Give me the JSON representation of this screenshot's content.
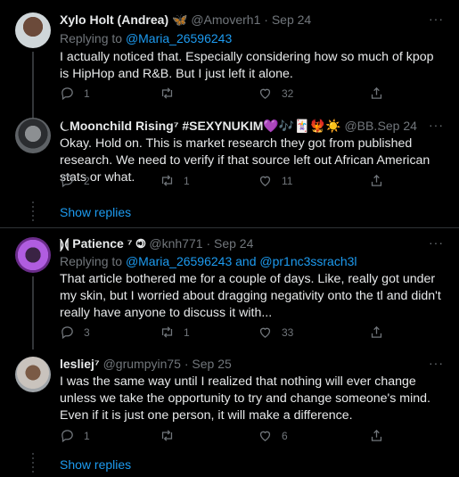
{
  "tweets": [
    {
      "name": "Xylo Holt (Andrea) 🦋",
      "handle": "@Amoverh1",
      "date": "Sep 24",
      "reply_prefix": "Replying to",
      "reply_mentions": "@Maria_26596243",
      "text": "I actually noticed that. Especially considering how so much of kpop is HipHop and R&B. But I just left it alone.",
      "replies": "1",
      "retweets": "",
      "likes": "32"
    },
    {
      "name": "⏾Moonchild Rising⁷ #SEXYNUKIM💜🎶🃏🐦‍🔥☀️",
      "handle": "@BB...",
      "date": "Sep 24",
      "text": "Okay. Hold on. This is market research they got from published research. We need to verify if that source left out African American stats or what.",
      "replies": "2",
      "retweets": "1",
      "likes": "11"
    },
    {
      "name": "⟭⟬ Patience ⁷ 🄯",
      "handle": "@knh771",
      "date": "Sep 24",
      "reply_prefix": "Replying to",
      "reply_mentions": "@Maria_26596243 and @pr1nc3ssrach3l",
      "text": "That article bothered me for a couple of days. Like, really got under my skin, but I worried about dragging negativity onto the tl and didn't really have anyone to discuss it with...",
      "replies": "3",
      "retweets": "1",
      "likes": "33"
    },
    {
      "name": "lesliej⁷",
      "handle": "@grumpyin75",
      "date": "Sep 25",
      "text": "I was the same way until I realized that nothing will ever change unless we take the opportunity to try and change someone's mind.  Even if it is just one person, it will make a difference.",
      "replies": "1",
      "retweets": "",
      "likes": "6"
    }
  ],
  "show_replies_label": "Show replies",
  "more_label": "···",
  "dot": "·",
  "colors": {
    "accent": "#1d9bf0",
    "muted": "#71767b",
    "background": "#000000"
  }
}
